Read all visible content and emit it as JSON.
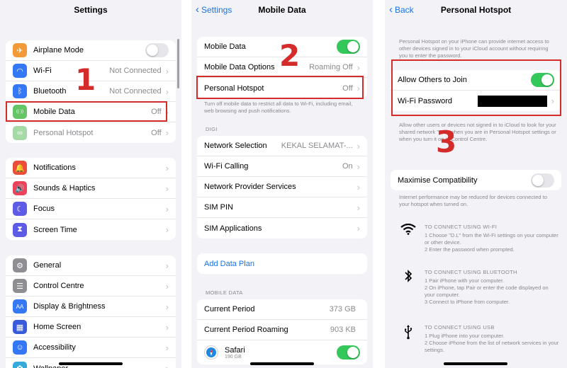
{
  "panel1": {
    "title": "Settings",
    "group1": [
      {
        "label": "Airplane Mode",
        "icon": "airplane-icon",
        "color": "#f19a37"
      },
      {
        "label": "Wi-Fi",
        "value": "Not Connected",
        "icon": "wifi-icon",
        "color": "#3478f6"
      },
      {
        "label": "Bluetooth",
        "value": "Not Connected",
        "icon": "bluetooth-icon",
        "color": "#3478f6"
      },
      {
        "label": "Mobile Data",
        "value": "Off",
        "icon": "antenna-icon",
        "color": "#65c466"
      },
      {
        "label": "Personal Hotspot",
        "value": "Off",
        "icon": "hotspot-icon",
        "color": "#a5d9a6"
      }
    ],
    "group2": [
      {
        "label": "Notifications",
        "icon": "bell-icon",
        "color": "#eb4d3d"
      },
      {
        "label": "Sounds & Haptics",
        "icon": "speaker-icon",
        "color": "#eb445a"
      },
      {
        "label": "Focus",
        "icon": "moon-icon",
        "color": "#5e5ce6"
      },
      {
        "label": "Screen Time",
        "icon": "hourglass-icon",
        "color": "#5e5ce6"
      }
    ],
    "group3": [
      {
        "label": "General",
        "icon": "gear-icon",
        "color": "#8e8e93"
      },
      {
        "label": "Control Centre",
        "icon": "switches-icon",
        "color": "#8e8e93"
      },
      {
        "label": "Display & Brightness",
        "icon": "display-icon",
        "color": "#3478f6",
        "glyph": "AA"
      },
      {
        "label": "Home Screen",
        "icon": "grid-icon",
        "color": "#3a5bd9"
      },
      {
        "label": "Accessibility",
        "icon": "accessibility-icon",
        "color": "#3478f6"
      },
      {
        "label": "Wallpaper",
        "icon": "wallpaper-icon",
        "color": "#35aadc"
      }
    ],
    "marker": "1"
  },
  "panel2": {
    "back": "Settings",
    "title": "Mobile Data",
    "group1": [
      {
        "label": "Mobile Data"
      },
      {
        "label": "Mobile Data Options",
        "value": "Roaming Off"
      },
      {
        "label": "Personal Hotspot",
        "value": "Off"
      }
    ],
    "note": "Turn off mobile data to restrict all data to Wi-Fi, including email, web browsing and push notifications.",
    "section_digi": "DIGI",
    "group2": [
      {
        "label": "Network Selection",
        "value": "KEKAL SELAMAT-..."
      },
      {
        "label": "Wi-Fi Calling",
        "value": "On"
      },
      {
        "label": "Network Provider Services"
      },
      {
        "label": "SIM PIN"
      },
      {
        "label": "SIM Applications"
      }
    ],
    "add_plan": "Add Data Plan",
    "section_mobile": "MOBILE DATA",
    "group3": [
      {
        "label": "Current Period",
        "value": "373 GB"
      },
      {
        "label": "Current Period Roaming",
        "value": "903 KB"
      }
    ],
    "safari": {
      "label": "Safari",
      "sub": "190 GB"
    },
    "marker": "2"
  },
  "panel3": {
    "back": "Back",
    "title": "Personal Hotspot",
    "intro": "Personal Hotspot on your iPhone can provide internet access to other devices signed in to your iCloud account without requiring you to enter the password.",
    "allow_label": "Allow Others to Join",
    "password_label": "Wi-Fi Password",
    "note2": "Allow other users or devices not signed in to iCloud to look for your shared network \"D.L\" when you are in Personal Hotspot settings or when you turn it on in Control Centre.",
    "maximise_label": "Maximise Compatibility",
    "note3": "Internet performance may be reduced for devices connected to your hotspot when turned on.",
    "wifi": {
      "head": "TO CONNECT USING WI-FI",
      "lines": [
        "1 Choose \"D.L\" from the Wi-Fi settings on your computer or other device.",
        "2 Enter the password when prompted."
      ]
    },
    "bluetooth": {
      "head": "TO CONNECT USING BLUETOOTH",
      "lines": [
        "1 Pair iPhone with your computer.",
        "2 On iPhone, tap Pair or enter the code displayed on your computer.",
        "3 Connect to iPhone from computer."
      ]
    },
    "usb": {
      "head": "TO CONNECT USING USB",
      "lines": [
        "1 Plug iPhone into your computer.",
        "2 Choose iPhone from the list of network services in your settings."
      ]
    },
    "marker": "3"
  }
}
